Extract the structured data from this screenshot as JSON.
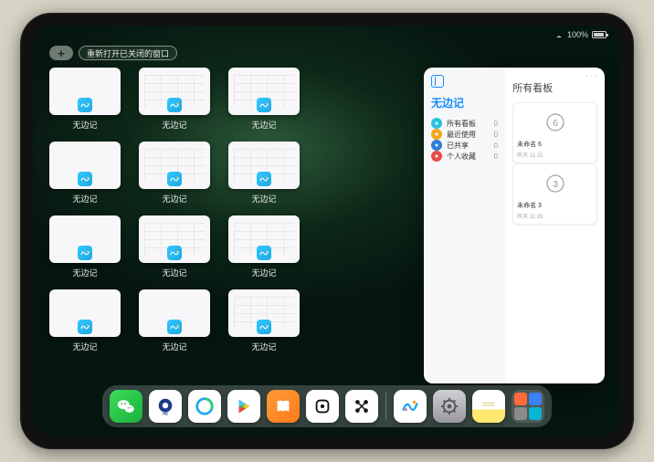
{
  "status": {
    "battery_pct": "100%"
  },
  "controls": {
    "add": "+",
    "reopen_label": "重新打开已关闭的窗口"
  },
  "windows": {
    "app_label": "无边记",
    "rows": [
      {
        "cards": [
          {
            "detailed": false
          },
          {
            "detailed": true
          },
          {
            "detailed": true
          }
        ]
      },
      {
        "cards": [
          {
            "detailed": false
          },
          {
            "detailed": true
          },
          {
            "detailed": true
          }
        ]
      },
      {
        "cards": [
          {
            "detailed": false
          },
          {
            "detailed": true
          },
          {
            "detailed": true
          }
        ]
      },
      {
        "cards": [
          {
            "detailed": false
          },
          {
            "detailed": false
          },
          {
            "detailed": true
          }
        ]
      }
    ]
  },
  "large_window": {
    "title": "无边记",
    "right_title": "所有看板",
    "more": "···",
    "sidebar_items": [
      {
        "label": "所有看板",
        "count": "0",
        "color": "#2bc0e4"
      },
      {
        "label": "最近使用",
        "count": "0",
        "color": "#f5a623"
      },
      {
        "label": "已共享",
        "count": "0",
        "color": "#2e7bd6"
      },
      {
        "label": "个人收藏",
        "count": "0",
        "color": "#e94b4b"
      }
    ],
    "boards": [
      {
        "name": "未命名 6",
        "sub": "昨天 11:25",
        "glyph": "6"
      },
      {
        "name": "未命名 3",
        "sub": "昨天 11:26",
        "glyph": "3"
      }
    ]
  },
  "dock": {
    "apps": [
      {
        "name": "wechat"
      },
      {
        "name": "browser-hd"
      },
      {
        "name": "qq-browser"
      },
      {
        "name": "play"
      },
      {
        "name": "books"
      },
      {
        "name": "dice"
      },
      {
        "name": "nodes"
      }
    ],
    "recent": [
      {
        "name": "freeform"
      },
      {
        "name": "settings"
      },
      {
        "name": "notes"
      }
    ],
    "group": {
      "minis": [
        "#ff6b3d",
        "#3b82f6",
        "#8b8b8b",
        "#06b6d4"
      ]
    }
  }
}
